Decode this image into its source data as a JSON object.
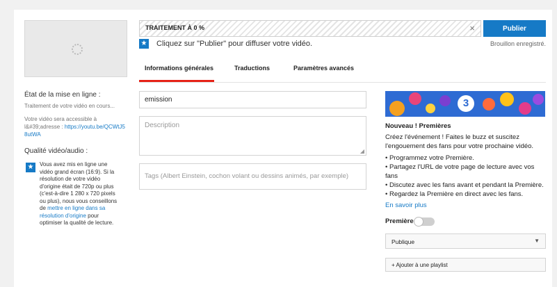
{
  "processing": {
    "label": "TRAITEMENT À 0 %",
    "percent": 0,
    "close_glyph": "×"
  },
  "publish": {
    "label": "Publier",
    "status": "Brouillon enregistré."
  },
  "info_line": {
    "icon": "star-icon",
    "text": "Cliquez sur \"Publier\" pour diffuser votre vidéo."
  },
  "tabs": [
    {
      "label": "Informations générales",
      "active": true
    },
    {
      "label": "Traductions",
      "active": false
    },
    {
      "label": "Paramètres avancés",
      "active": false
    }
  ],
  "upload_status": {
    "title": "État de la mise en ligne :",
    "processing_text": "Traitement de votre vidéo en cours...",
    "accessible_text": "Votre vidéo sera accessible à l&#39;adresse : ",
    "url": "https://youtu.be/QCWtJ58utWA"
  },
  "quality": {
    "title": "Qualité vidéo/audio :",
    "text_before": "Vous avez mis en ligne une vidéo grand écran (16:9). Si la résolution de votre vidéo d'origine était de 720p ou plus (c'est-à-dire 1 280 x 720 pixels ou plus), nous vous conseillons de ",
    "link": "mettre en ligne dans sa résolution d'origine",
    "text_after": " pour optimiser la qualité de lecture."
  },
  "form": {
    "title_value": "emission",
    "description_placeholder": "Description",
    "tags_placeholder": "Tags (Albert Einstein, cochon volant ou dessins animés, par exemple)"
  },
  "premieres": {
    "banner_number": "3",
    "title": "Nouveau ! Premières",
    "intro": "Créez l'événement ! Faites le buzz et suscitez l'engouement des fans pour votre prochaine vidéo.",
    "bullets": [
      "• Programmez votre Première.",
      "• Partagez l'URL de votre page de lecture avec vos fans",
      "• Discutez avec les fans avant et pendant la Première.",
      "• Regardez la Première en direct avec les fans."
    ],
    "learn_more": "En savoir plus",
    "toggle_label": "Première",
    "toggle_on": false
  },
  "visibility": {
    "selected": "Publique",
    "arrow": "▼"
  },
  "playlist": {
    "label": "+ Ajouter à une playlist"
  },
  "colors": {
    "accent": "#167ac6",
    "tab_active": "#e62117"
  }
}
